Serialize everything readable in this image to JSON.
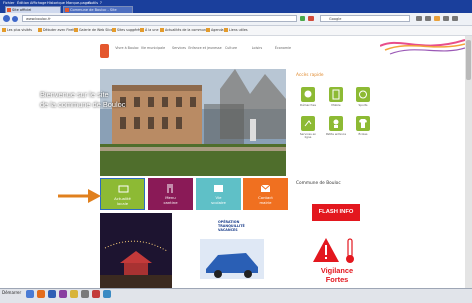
{
  "browser": {
    "menu": [
      "Fichier",
      "Édition",
      "Affichage",
      "Historique",
      "Marque-pages",
      "Outils",
      "?"
    ],
    "tabs": [
      {
        "label": "Site officiel",
        "active": true
      },
      {
        "label": "Commune de Bouloc - Site",
        "active": false
      }
    ],
    "url": "www.bouloc.fr",
    "search_placeholder": "Google",
    "bookmarks": [
      "Les plus visités",
      "Débuter avec Firefox",
      "Galerie de Web Slices",
      "Sites suggérés",
      "À la une",
      "Actualités de la commune",
      "Agenda",
      "Liens utiles"
    ]
  },
  "site": {
    "brand_color": "#e4572e",
    "nav": [
      "Vivre à Bouloc",
      "Vie municipale",
      "Services",
      "Enfance et jeunesse",
      "Culture",
      "Loisirs",
      "Économie"
    ],
    "hero_text": [
      "Bienvenue sur le site",
      "de la commune de Bouloc"
    ],
    "quick_access_title": "Accès rapide",
    "quick_access": [
      {
        "label": "Démarches",
        "icon": "hand-icon"
      },
      {
        "label": "Mobile",
        "icon": "phone-icon"
      },
      {
        "label": "Sports",
        "icon": "ball-icon"
      },
      {
        "label": "Services en ligne",
        "icon": "arrow-icon"
      },
      {
        "label": "Petite enfance",
        "icon": "baby-icon"
      },
      {
        "label": "Écoles",
        "icon": "shirt-icon"
      }
    ],
    "tiles": [
      {
        "label": "Actualité",
        "label2": "locale",
        "color": "#8dba34",
        "icon": "monitor-icon"
      },
      {
        "label": "Menu",
        "label2": "cantine",
        "color": "#8a1a57",
        "icon": "cutlery-icon"
      },
      {
        "label": "Vie",
        "label2": "scolaire",
        "color": "#5fc0c7",
        "icon": "book-icon"
      },
      {
        "label": "Contact",
        "label2": "mairie",
        "color": "#f07020",
        "icon": "envelope-icon"
      }
    ],
    "side_title": "Commune de Bouloc",
    "flash_info": "FLASH INFO",
    "vigilance": [
      "Vigilance",
      "Fortes"
    ],
    "operation": [
      "OPÉRATION",
      "TRANQUILLITÉ",
      "VACANCES"
    ]
  },
  "taskbar": {
    "start_label": "Démarrer"
  }
}
